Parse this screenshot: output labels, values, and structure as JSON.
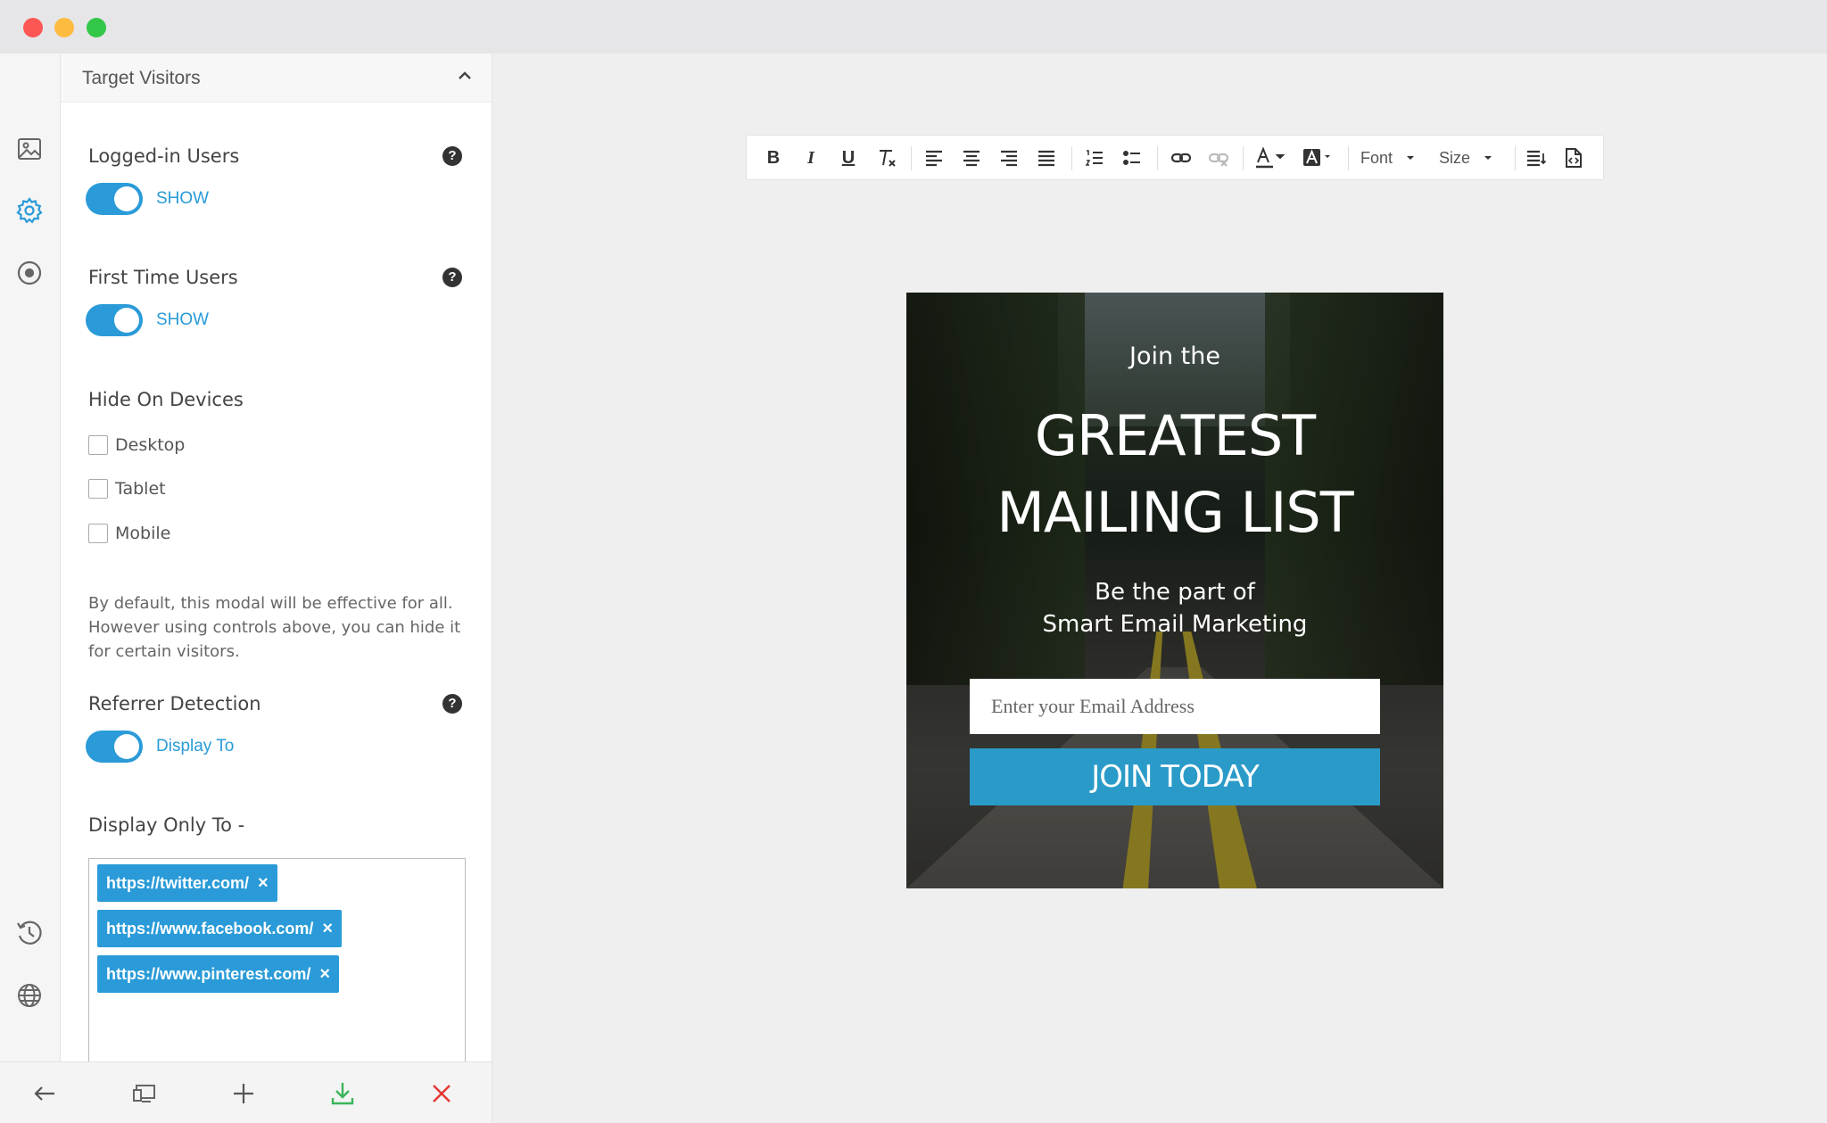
{
  "panel": {
    "section_title": "Target Visitors",
    "logged_in": {
      "label": "Logged-in Users",
      "toggle_text": "SHOW",
      "help": "?"
    },
    "first_time": {
      "label": "First Time Users",
      "toggle_text": "SHOW",
      "help": "?"
    },
    "hide_devices": {
      "label": "Hide On Devices",
      "options": [
        "Desktop",
        "Tablet",
        "Mobile"
      ]
    },
    "note": "By default, this modal will be effective for all. However using controls above, you can hide it for certain visitors.",
    "referrer": {
      "label": "Referrer Detection",
      "toggle_text": "Display To",
      "help": "?"
    },
    "display_only": {
      "label": "Display Only To -",
      "urls": [
        "https://twitter.com/",
        "https://www.facebook.com/",
        "https://www.pinterest.com/"
      ],
      "remove_symbol": "×"
    }
  },
  "toolbar": {
    "bold": "B",
    "italic": "I",
    "underline": "U",
    "font_label": "Font",
    "size_label": "Size"
  },
  "popup": {
    "pre_title": "Join the",
    "title_line1": "GREATEST",
    "title_line2": "MAILING LIST",
    "subtitle_line1": "Be the part of",
    "subtitle_line2": "Smart Email Marketing",
    "email_placeholder": "Enter your Email Address",
    "button_label": "JOIN TODAY"
  },
  "colors": {
    "accent": "#2a9bd8",
    "button": "#2a9bc8",
    "download": "#3cb55a",
    "close": "#e53935"
  },
  "icons": {
    "rail": [
      "image-icon",
      "gear-icon",
      "target-icon",
      "history-icon",
      "globe-icon"
    ],
    "actions": [
      "back-arrow-icon",
      "devices-icon",
      "plus-icon",
      "download-icon",
      "close-icon"
    ]
  }
}
